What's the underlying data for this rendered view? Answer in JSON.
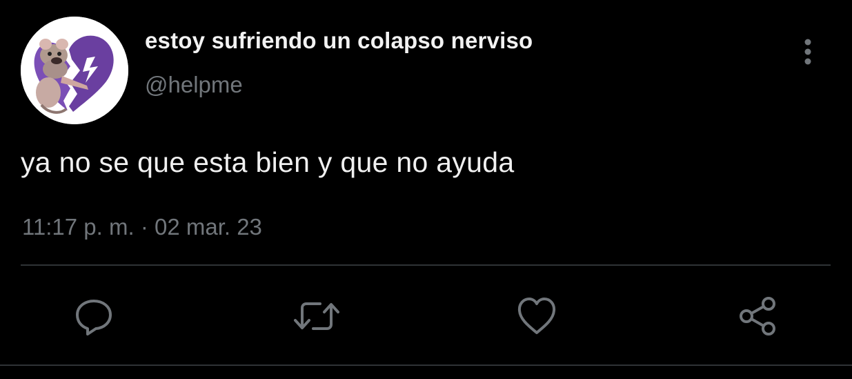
{
  "tweet": {
    "display_name": "estoy sufriendo un colapso nerviso",
    "handle": "@helpme",
    "text": "ya no se que esta bien y que no ayuda",
    "timestamp": "11:17 p. m. · 02 mar. 23"
  },
  "icons": {
    "avatar": "avatar-broken-heart-rat",
    "more": "more-vertical-icon",
    "reply": "reply-icon",
    "retweet": "retweet-icon",
    "like": "like-heart-icon",
    "share": "share-icon"
  },
  "colors": {
    "background": "#000000",
    "primary_text": "#e7e9ea",
    "secondary_text": "#71767b",
    "divider": "#2f3336",
    "icon": "#71767b",
    "avatar_heart": "#6a3fa0"
  }
}
